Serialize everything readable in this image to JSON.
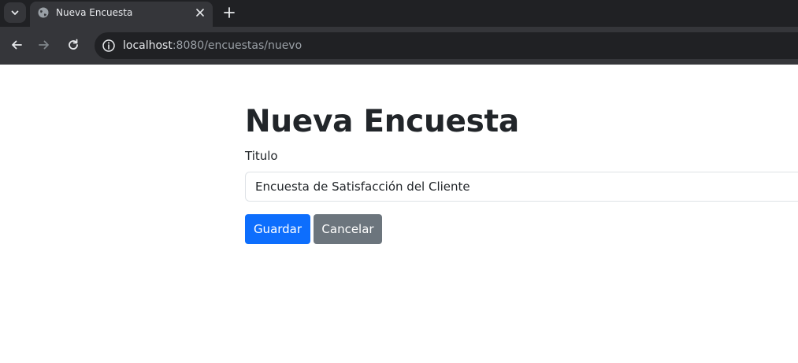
{
  "browser": {
    "tab": {
      "title": "Nueva Encuesta"
    },
    "address_bar": {
      "host": "localhost",
      "path": ":8080/encuestas/nuevo"
    }
  },
  "icons": {
    "tab_search": "chevron-down-icon",
    "favicon": "globe-icon",
    "tab_close": "close-icon",
    "new_tab": "plus-icon",
    "back": "arrow-left-icon",
    "forward": "arrow-right-icon",
    "reload": "reload-icon",
    "site_info": "info-icon"
  },
  "form": {
    "heading": "Nueva Encuesta",
    "titulo_label": "Titulo",
    "titulo_value": "Encuesta de Satisfacción del Cliente",
    "save_label": "Guardar",
    "cancel_label": "Cancelar"
  },
  "colors": {
    "primary": "#0d6efd",
    "secondary": "#6c757d",
    "text": "#212529",
    "chrome_dark": "#202124",
    "chrome_mid": "#35363a"
  }
}
